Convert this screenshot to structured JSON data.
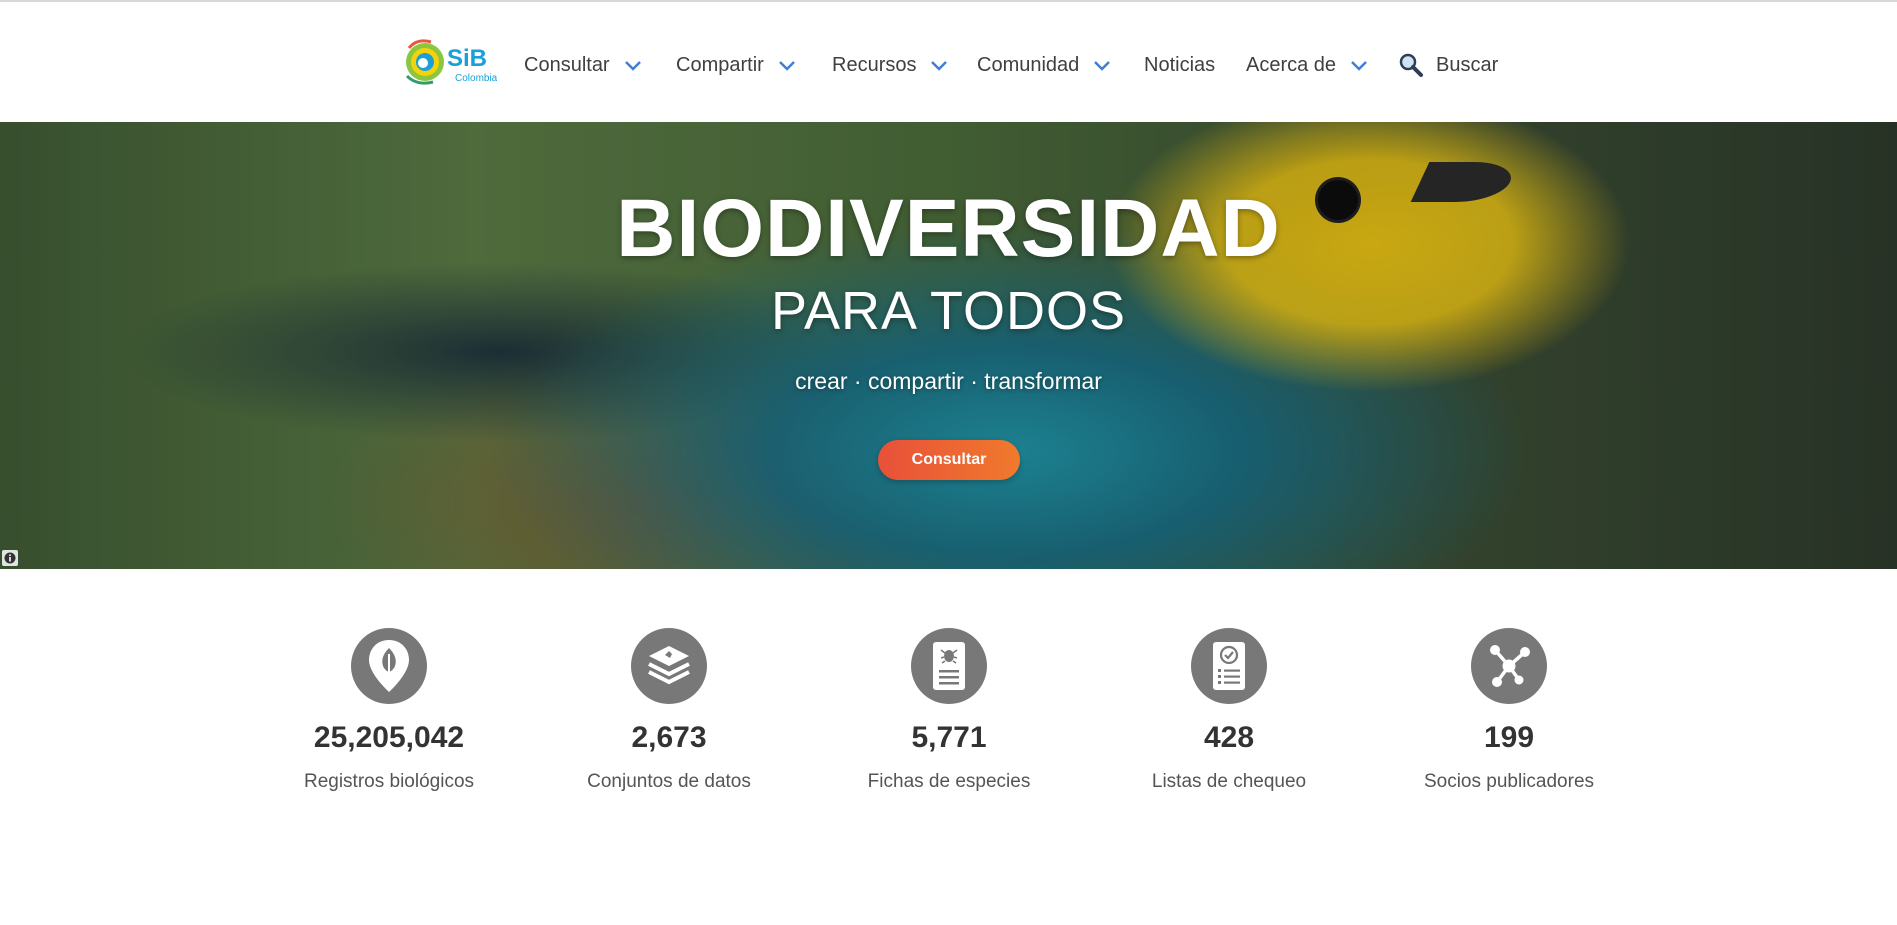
{
  "nav": {
    "logo_text": "SiB",
    "logo_subtext": "Colombia",
    "items": [
      {
        "label": "Consultar",
        "has_dropdown": true
      },
      {
        "label": "Compartir",
        "has_dropdown": true
      },
      {
        "label": "Recursos",
        "has_dropdown": true
      },
      {
        "label": "Comunidad",
        "has_dropdown": true
      },
      {
        "label": "Noticias",
        "has_dropdown": false
      },
      {
        "label": "Acerca de",
        "has_dropdown": true
      }
    ],
    "search_label": "Buscar",
    "chevron_color": "#3f7fd6"
  },
  "hero": {
    "title": "BIODIVERSIDAD",
    "subtitle": "PARA TODOS",
    "tagline": "crear · compartir · transformar",
    "button_label": "Consultar",
    "button_color": "#ee6634"
  },
  "stats": [
    {
      "icon": "location-leaf-icon",
      "value": "25,205,042",
      "label": "Registros biológicos"
    },
    {
      "icon": "database-layers-icon",
      "value": "2,673",
      "label": "Conjuntos de datos"
    },
    {
      "icon": "species-sheet-icon",
      "value": "5,771",
      "label": "Fichas de especies"
    },
    {
      "icon": "checklist-icon",
      "value": "428",
      "label": "Listas de chequeo"
    },
    {
      "icon": "network-nodes-icon",
      "value": "199",
      "label": "Socios publicadores"
    }
  ]
}
